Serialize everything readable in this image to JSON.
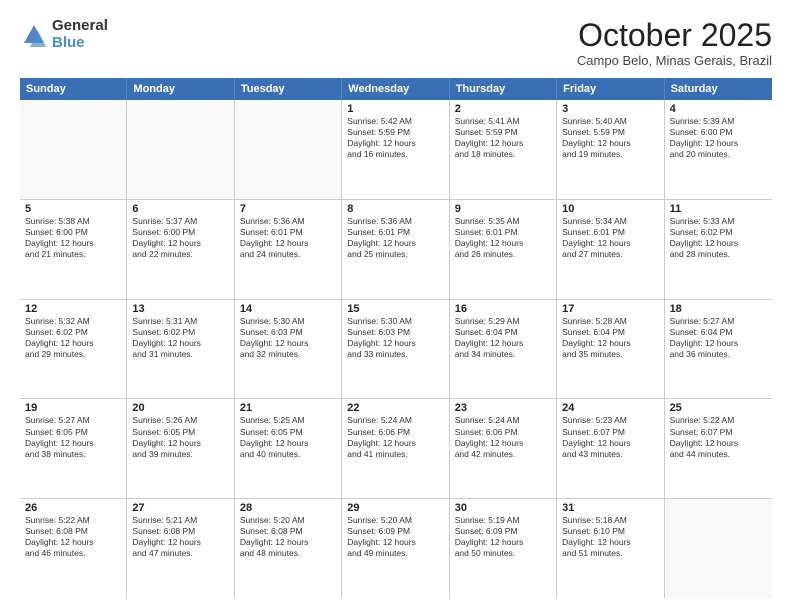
{
  "logo": {
    "general": "General",
    "blue": "Blue"
  },
  "header": {
    "month": "October 2025",
    "location": "Campo Belo, Minas Gerais, Brazil"
  },
  "weekdays": [
    "Sunday",
    "Monday",
    "Tuesday",
    "Wednesday",
    "Thursday",
    "Friday",
    "Saturday"
  ],
  "rows": [
    [
      {
        "day": "",
        "empty": true
      },
      {
        "day": "",
        "empty": true
      },
      {
        "day": "",
        "empty": true
      },
      {
        "day": "1",
        "lines": [
          "Sunrise: 5:42 AM",
          "Sunset: 5:59 PM",
          "Daylight: 12 hours",
          "and 16 minutes."
        ]
      },
      {
        "day": "2",
        "lines": [
          "Sunrise: 5:41 AM",
          "Sunset: 5:59 PM",
          "Daylight: 12 hours",
          "and 18 minutes."
        ]
      },
      {
        "day": "3",
        "lines": [
          "Sunrise: 5:40 AM",
          "Sunset: 5:59 PM",
          "Daylight: 12 hours",
          "and 19 minutes."
        ]
      },
      {
        "day": "4",
        "lines": [
          "Sunrise: 5:39 AM",
          "Sunset: 6:00 PM",
          "Daylight: 12 hours",
          "and 20 minutes."
        ]
      }
    ],
    [
      {
        "day": "5",
        "lines": [
          "Sunrise: 5:38 AM",
          "Sunset: 6:00 PM",
          "Daylight: 12 hours",
          "and 21 minutes."
        ]
      },
      {
        "day": "6",
        "lines": [
          "Sunrise: 5:37 AM",
          "Sunset: 6:00 PM",
          "Daylight: 12 hours",
          "and 22 minutes."
        ]
      },
      {
        "day": "7",
        "lines": [
          "Sunrise: 5:36 AM",
          "Sunset: 6:01 PM",
          "Daylight: 12 hours",
          "and 24 minutes."
        ]
      },
      {
        "day": "8",
        "lines": [
          "Sunrise: 5:36 AM",
          "Sunset: 6:01 PM",
          "Daylight: 12 hours",
          "and 25 minutes."
        ]
      },
      {
        "day": "9",
        "lines": [
          "Sunrise: 5:35 AM",
          "Sunset: 6:01 PM",
          "Daylight: 12 hours",
          "and 26 minutes."
        ]
      },
      {
        "day": "10",
        "lines": [
          "Sunrise: 5:34 AM",
          "Sunset: 6:01 PM",
          "Daylight: 12 hours",
          "and 27 minutes."
        ]
      },
      {
        "day": "11",
        "lines": [
          "Sunrise: 5:33 AM",
          "Sunset: 6:02 PM",
          "Daylight: 12 hours",
          "and 28 minutes."
        ]
      }
    ],
    [
      {
        "day": "12",
        "lines": [
          "Sunrise: 5:32 AM",
          "Sunset: 6:02 PM",
          "Daylight: 12 hours",
          "and 29 minutes."
        ]
      },
      {
        "day": "13",
        "lines": [
          "Sunrise: 5:31 AM",
          "Sunset: 6:02 PM",
          "Daylight: 12 hours",
          "and 31 minutes."
        ]
      },
      {
        "day": "14",
        "lines": [
          "Sunrise: 5:30 AM",
          "Sunset: 6:03 PM",
          "Daylight: 12 hours",
          "and 32 minutes."
        ]
      },
      {
        "day": "15",
        "lines": [
          "Sunrise: 5:30 AM",
          "Sunset: 6:03 PM",
          "Daylight: 12 hours",
          "and 33 minutes."
        ]
      },
      {
        "day": "16",
        "lines": [
          "Sunrise: 5:29 AM",
          "Sunset: 6:04 PM",
          "Daylight: 12 hours",
          "and 34 minutes."
        ]
      },
      {
        "day": "17",
        "lines": [
          "Sunrise: 5:28 AM",
          "Sunset: 6:04 PM",
          "Daylight: 12 hours",
          "and 35 minutes."
        ]
      },
      {
        "day": "18",
        "lines": [
          "Sunrise: 5:27 AM",
          "Sunset: 6:04 PM",
          "Daylight: 12 hours",
          "and 36 minutes."
        ]
      }
    ],
    [
      {
        "day": "19",
        "lines": [
          "Sunrise: 5:27 AM",
          "Sunset: 6:05 PM",
          "Daylight: 12 hours",
          "and 38 minutes."
        ]
      },
      {
        "day": "20",
        "lines": [
          "Sunrise: 5:26 AM",
          "Sunset: 6:05 PM",
          "Daylight: 12 hours",
          "and 39 minutes."
        ]
      },
      {
        "day": "21",
        "lines": [
          "Sunrise: 5:25 AM",
          "Sunset: 6:05 PM",
          "Daylight: 12 hours",
          "and 40 minutes."
        ]
      },
      {
        "day": "22",
        "lines": [
          "Sunrise: 5:24 AM",
          "Sunset: 6:06 PM",
          "Daylight: 12 hours",
          "and 41 minutes."
        ]
      },
      {
        "day": "23",
        "lines": [
          "Sunrise: 5:24 AM",
          "Sunset: 6:06 PM",
          "Daylight: 12 hours",
          "and 42 minutes."
        ]
      },
      {
        "day": "24",
        "lines": [
          "Sunrise: 5:23 AM",
          "Sunset: 6:07 PM",
          "Daylight: 12 hours",
          "and 43 minutes."
        ]
      },
      {
        "day": "25",
        "lines": [
          "Sunrise: 5:22 AM",
          "Sunset: 6:07 PM",
          "Daylight: 12 hours",
          "and 44 minutes."
        ]
      }
    ],
    [
      {
        "day": "26",
        "lines": [
          "Sunrise: 5:22 AM",
          "Sunset: 6:08 PM",
          "Daylight: 12 hours",
          "and 46 minutes."
        ]
      },
      {
        "day": "27",
        "lines": [
          "Sunrise: 5:21 AM",
          "Sunset: 6:08 PM",
          "Daylight: 12 hours",
          "and 47 minutes."
        ]
      },
      {
        "day": "28",
        "lines": [
          "Sunrise: 5:20 AM",
          "Sunset: 6:08 PM",
          "Daylight: 12 hours",
          "and 48 minutes."
        ]
      },
      {
        "day": "29",
        "lines": [
          "Sunrise: 5:20 AM",
          "Sunset: 6:09 PM",
          "Daylight: 12 hours",
          "and 49 minutes."
        ]
      },
      {
        "day": "30",
        "lines": [
          "Sunrise: 5:19 AM",
          "Sunset: 6:09 PM",
          "Daylight: 12 hours",
          "and 50 minutes."
        ]
      },
      {
        "day": "31",
        "lines": [
          "Sunrise: 5:18 AM",
          "Sunset: 6:10 PM",
          "Daylight: 12 hours",
          "and 51 minutes."
        ]
      },
      {
        "day": "",
        "empty": true
      }
    ]
  ]
}
